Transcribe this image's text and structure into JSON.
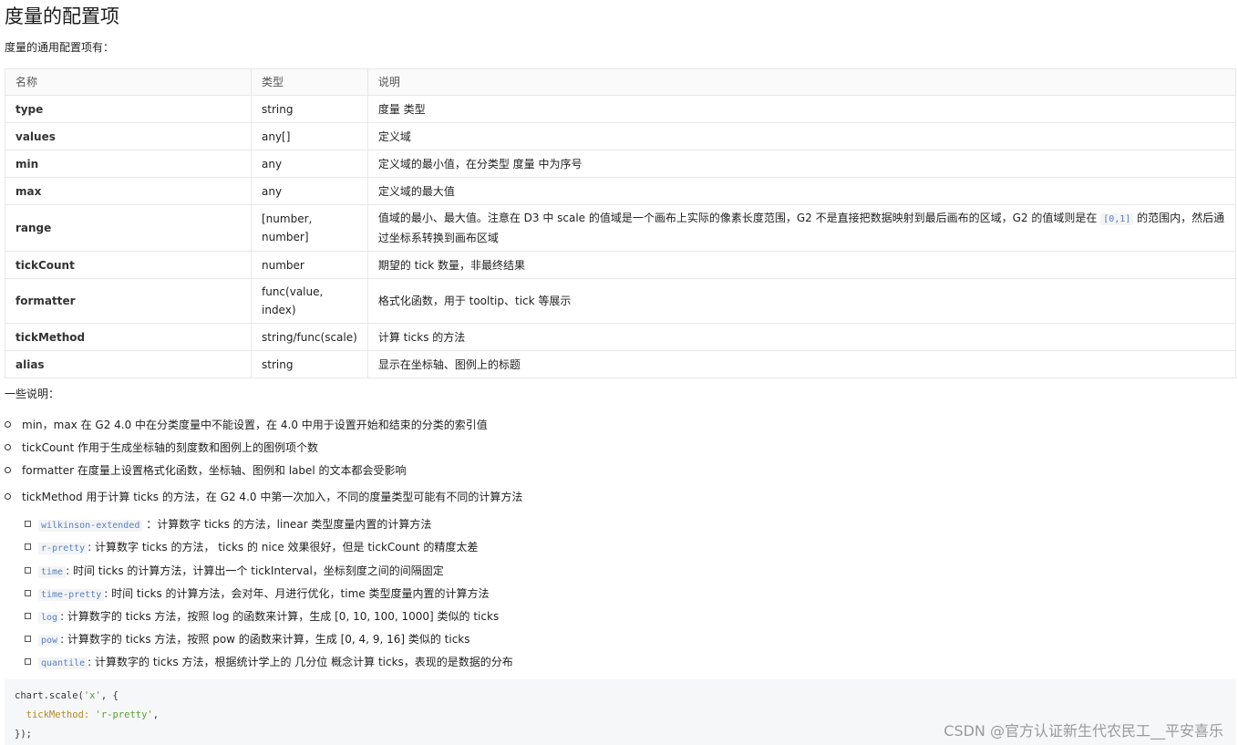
{
  "title": "度量的配置项",
  "intro": "度量的通用配置项有：",
  "table": {
    "headers": [
      "名称",
      "类型",
      "说明"
    ],
    "rows": [
      {
        "name": "type",
        "type": "string",
        "desc": "度量 类型"
      },
      {
        "name": "values",
        "type": "any[]",
        "desc": "定义域"
      },
      {
        "name": "min",
        "type": "any",
        "desc": "定义域的最小值，在分类型 度量 中为序号"
      },
      {
        "name": "max",
        "type": "any",
        "desc": "定义域的最大值"
      },
      {
        "name": "range",
        "type": "[number, number]",
        "desc_a": "值域的最小、最大值。注意在 D3 中 scale 的值域是一个画布上实际的像素长度范围，G2 不是直接把数据映射到最后画布的区域，G2 的值域则是在 ",
        "desc_code": "[0,1]",
        "desc_b": " 的范围内，然后通过坐标系转换到画布区域"
      },
      {
        "name": "tickCount",
        "type": "number",
        "desc": "期望的 tick 数量，非最终结果"
      },
      {
        "name": "formatter",
        "type": "func(value, index)",
        "desc": "格式化函数，用于 tooltip、tick 等展示"
      },
      {
        "name": "tickMethod",
        "type": "string/func(scale)",
        "desc": "计算 ticks 的方法"
      },
      {
        "name": "alias",
        "type": "string",
        "desc": "显示在坐标轴、图例上的标题"
      }
    ]
  },
  "notes_title": "一些说明：",
  "bullets": [
    "min，max 在 G2 4.0 中在分类度量中不能设置，在 4.0 中用于设置开始和结束的分类的索引值",
    "tickCount 作用于生成坐标轴的刻度数和图例上的图例项个数",
    "formatter 在度量上设置格式化函数，坐标轴、图例和 label 的文本都会受影响",
    "tickMethod 用于计算 ticks 的方法，在 G2 4.0 中第一次加入，不同的度量类型可能有不同的计算方法"
  ],
  "sub_bullets": [
    {
      "code": "wilkinson-extended",
      "text": " ：计算数字 ticks 的方法，linear 类型度量内置的计算方法"
    },
    {
      "code": "r-pretty",
      "text": ": 计算数字 ticks 的方法， ticks 的 nice 效果很好，但是 tickCount 的精度太差"
    },
    {
      "code": "time",
      "text": ": 时间 ticks 的计算方法，计算出一个 tickInterval，坐标刻度之间的间隔固定"
    },
    {
      "code": "time-pretty",
      "text": ": 时间 ticks 的计算方法，会对年、月进行优化，time 类型度量内置的计算方法"
    },
    {
      "code": "log",
      "text": ": 计算数字的 ticks 方法，按照 log 的函数来计算，生成 [0, 10, 100, 1000] 类似的 ticks"
    },
    {
      "code": "pow",
      "text": ": 计算数字的 ticks 方法，按照 pow 的函数来计算，生成 [0, 4, 9, 16] 类似的 ticks"
    },
    {
      "code": "quantile",
      "text": ": 计算数字的 ticks 方法，根据统计学上的 几分位 概念计算 ticks，表现的是数据的分布"
    }
  ],
  "code": {
    "line1_a": "chart.scale(",
    "line1_str": "'x'",
    "line1_b": ", {",
    "line2_key": "  tickMethod:",
    "line2_str": " 'r-pretty'",
    "line2_b": ",",
    "line3": "});"
  },
  "watermark": "CSDN @官方认证新生代农民工__平安喜乐"
}
